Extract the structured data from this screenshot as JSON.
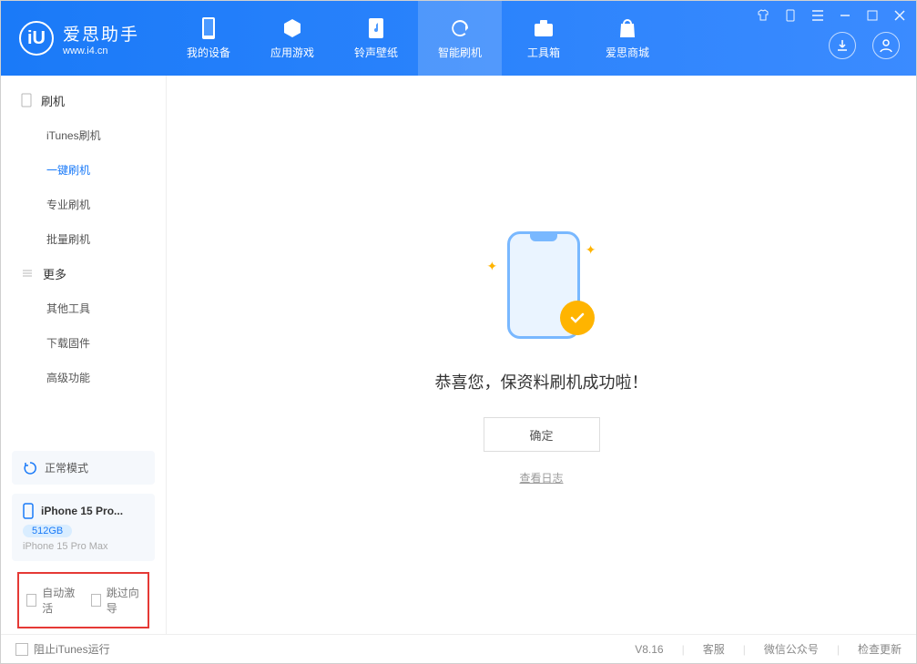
{
  "app": {
    "title": "爱思助手",
    "subtitle": "www.i4.cn"
  },
  "nav": {
    "tabs": [
      {
        "label": "我的设备"
      },
      {
        "label": "应用游戏"
      },
      {
        "label": "铃声壁纸"
      },
      {
        "label": "智能刷机"
      },
      {
        "label": "工具箱"
      },
      {
        "label": "爱思商城"
      }
    ],
    "active_index": 3
  },
  "sidebar": {
    "groups": [
      {
        "title": "刷机",
        "items": [
          {
            "label": "iTunes刷机"
          },
          {
            "label": "一键刷机",
            "active": true
          },
          {
            "label": "专业刷机"
          },
          {
            "label": "批量刷机"
          }
        ]
      },
      {
        "title": "更多",
        "items": [
          {
            "label": "其他工具"
          },
          {
            "label": "下载固件"
          },
          {
            "label": "高级功能"
          }
        ]
      }
    ],
    "status": {
      "label": "正常模式"
    },
    "device": {
      "name": "iPhone 15 Pro...",
      "storage": "512GB",
      "model": "iPhone 15 Pro Max"
    },
    "checks": [
      {
        "label": "自动激活"
      },
      {
        "label": "跳过向导"
      }
    ]
  },
  "main": {
    "success_text": "恭喜您，保资料刷机成功啦！",
    "ok_label": "确定",
    "log_label": "查看日志"
  },
  "footer": {
    "block_itunes": "阻止iTunes运行",
    "version": "V8.16",
    "links": [
      "客服",
      "微信公众号",
      "检查更新"
    ]
  }
}
